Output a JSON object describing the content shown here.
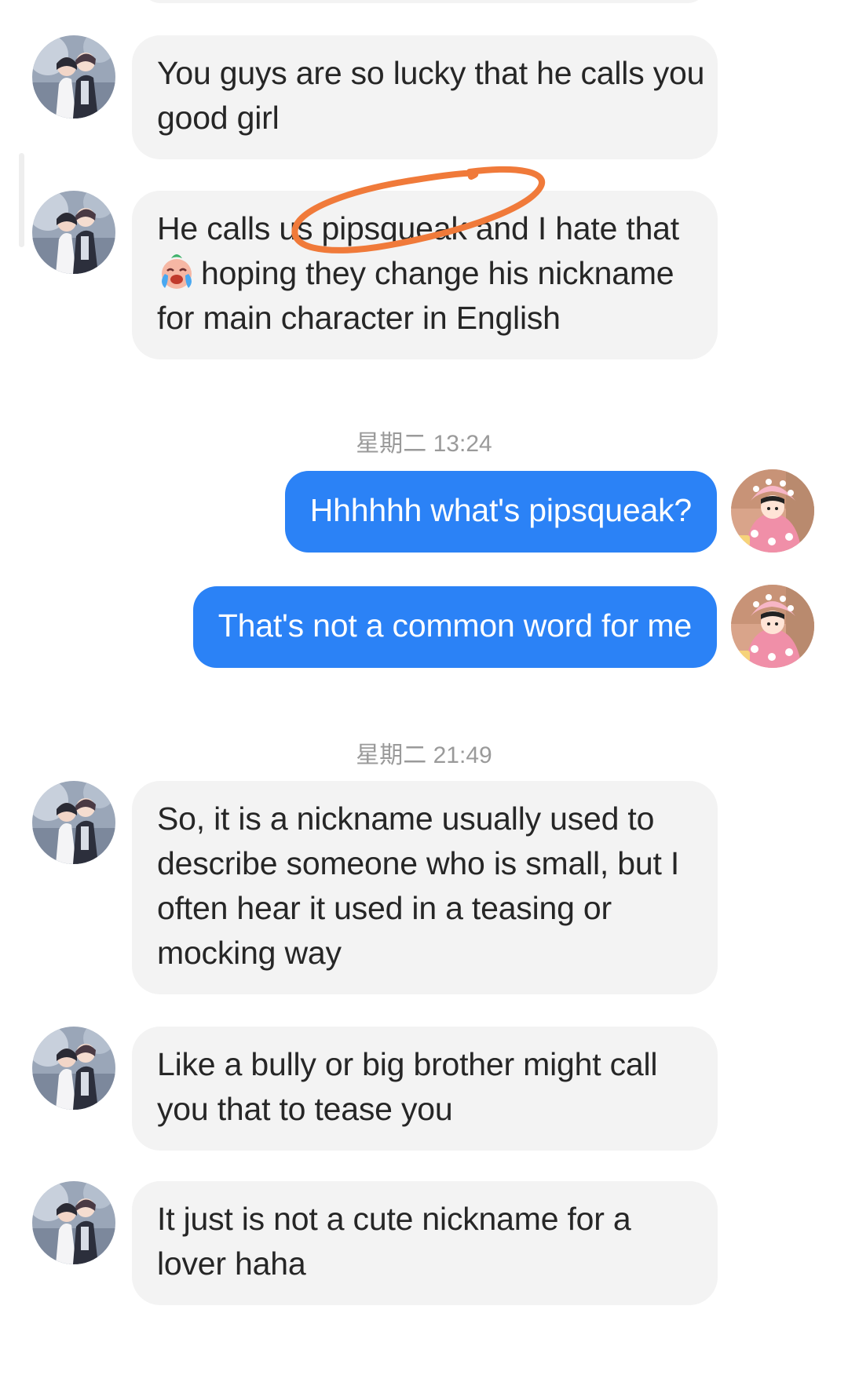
{
  "contact": {
    "avatar_icon": "contact-avatar-couple-illustration"
  },
  "self": {
    "avatar_icon": "self-avatar-girl-in-pink-hat"
  },
  "colors": {
    "incoming_bubble": "#f3f3f3",
    "outgoing_bubble": "#2b82f6",
    "timestamp_text": "#9a9a9a",
    "annotation_stroke": "#f07a3a"
  },
  "messages": [
    {
      "direction": "incoming",
      "lines": [
        "You guys are so lucky that he calls you",
        "good girl"
      ]
    },
    {
      "direction": "incoming",
      "lines": [
        "He calls us pipsqueak and I hate that",
        "hoping they change his nickname",
        "for main character in English"
      ],
      "emoji": "crying-face-emoji"
    },
    {
      "type": "timestamp",
      "text": "星期二 13:24"
    },
    {
      "direction": "outgoing",
      "text": "Hhhhhh what's pipsqueak?"
    },
    {
      "direction": "outgoing",
      "text": "That's not a common word for me"
    },
    {
      "type": "timestamp",
      "text": "星期二 21:49"
    },
    {
      "direction": "incoming",
      "lines": [
        "So, it is a nickname usually used to",
        "describe someone who is small, but I",
        "often hear it used in a teasing or",
        "mocking way"
      ]
    },
    {
      "direction": "incoming",
      "lines": [
        "Like a bully or big brother might call",
        "you that to tease you"
      ]
    },
    {
      "direction": "incoming",
      "lines": [
        "It just is not a cute nickname for a",
        "lover haha"
      ]
    }
  ],
  "annotation": {
    "type": "hand-drawn-circle",
    "target_word": "pipsqueak"
  }
}
